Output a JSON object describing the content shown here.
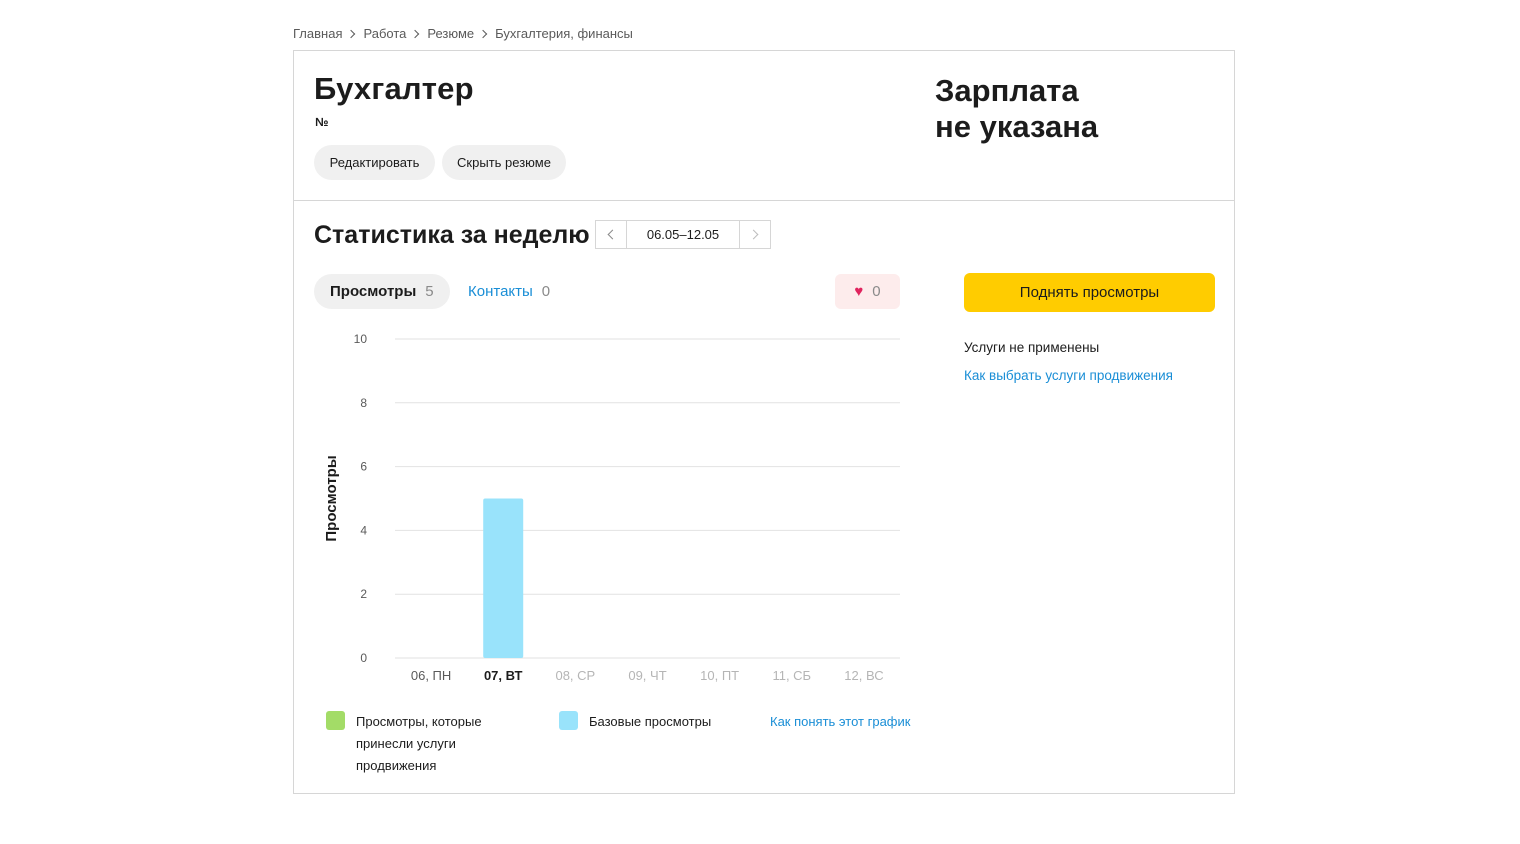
{
  "breadcrumb": [
    "Главная",
    "Работа",
    "Резюме",
    "Бухгалтерия, финансы"
  ],
  "resume": {
    "title": "Бухгалтер",
    "number_label": "№",
    "edit_label": "Редактировать",
    "hide_label": "Скрыть резюме",
    "salary_line1": "Зарплата",
    "salary_line2": "не указана"
  },
  "stats": {
    "title": "Статистика за неделю",
    "week_range": "06.05–12.05",
    "tabs": [
      {
        "label": "Просмотры",
        "count": "5",
        "active": true
      },
      {
        "label": "Контакты",
        "count": "0",
        "active": false
      }
    ],
    "likes_count": "0",
    "legend": {
      "promo_label": "Просмотры, которые принесли услуги продвижения",
      "base_label": "Базовые просмотры",
      "help_link": "Как понять этот график"
    }
  },
  "promotion": {
    "button_label": "Поднять просмотры",
    "status_text": "Услуги не применены",
    "help_link": "Как выбрать услуги продвижения"
  },
  "colors": {
    "accent_yellow": "#ffcc00",
    "link_blue": "#1a8ed6",
    "base_views": "#99e3fb",
    "promo_views": "#a3dc67",
    "like_red": "#e0245e"
  },
  "chart_data": {
    "type": "bar",
    "ylabel": "Просмотры",
    "categories": [
      "06, ПН",
      "07, ВТ",
      "08, СР",
      "09, ЧТ",
      "10, ПТ",
      "11, СБ",
      "12, ВС"
    ],
    "highlighted_category": "07, ВТ",
    "dimmed_categories": [
      "08, СР",
      "09, ЧТ",
      "10, ПТ",
      "11, СБ",
      "12, ВС"
    ],
    "series": [
      {
        "name": "Просмотры, которые принесли услуги продвижения",
        "color": "#a3dc67",
        "values": [
          0,
          0,
          0,
          0,
          0,
          0,
          0
        ]
      },
      {
        "name": "Базовые просмотры",
        "color": "#99e3fb",
        "values": [
          0,
          5,
          0,
          0,
          0,
          0,
          0
        ]
      }
    ],
    "yticks": [
      0,
      2,
      4,
      6,
      8,
      10
    ],
    "ylim": [
      0,
      10
    ],
    "grid": true
  }
}
